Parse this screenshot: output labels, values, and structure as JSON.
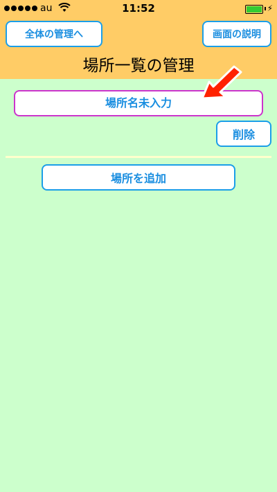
{
  "status_bar": {
    "carrier": "au",
    "time": "11:52"
  },
  "header": {
    "left_button": "全体の管理へ",
    "right_button": "画面の説明",
    "title": "場所一覧の管理"
  },
  "location": {
    "name_placeholder": "場所名未入力",
    "delete_label": "削除"
  },
  "add_button": "場所を追加",
  "colors": {
    "header": "#ffcc66",
    "background": "#ccffcc",
    "button_border": "#1a9ee8",
    "input_border": "#cc33cc",
    "arrow": "#ff2200"
  },
  "icons": [
    "signal-dots-icon",
    "wifi-icon",
    "battery-icon",
    "charging-bolt-icon",
    "pointer-arrow-icon"
  ]
}
